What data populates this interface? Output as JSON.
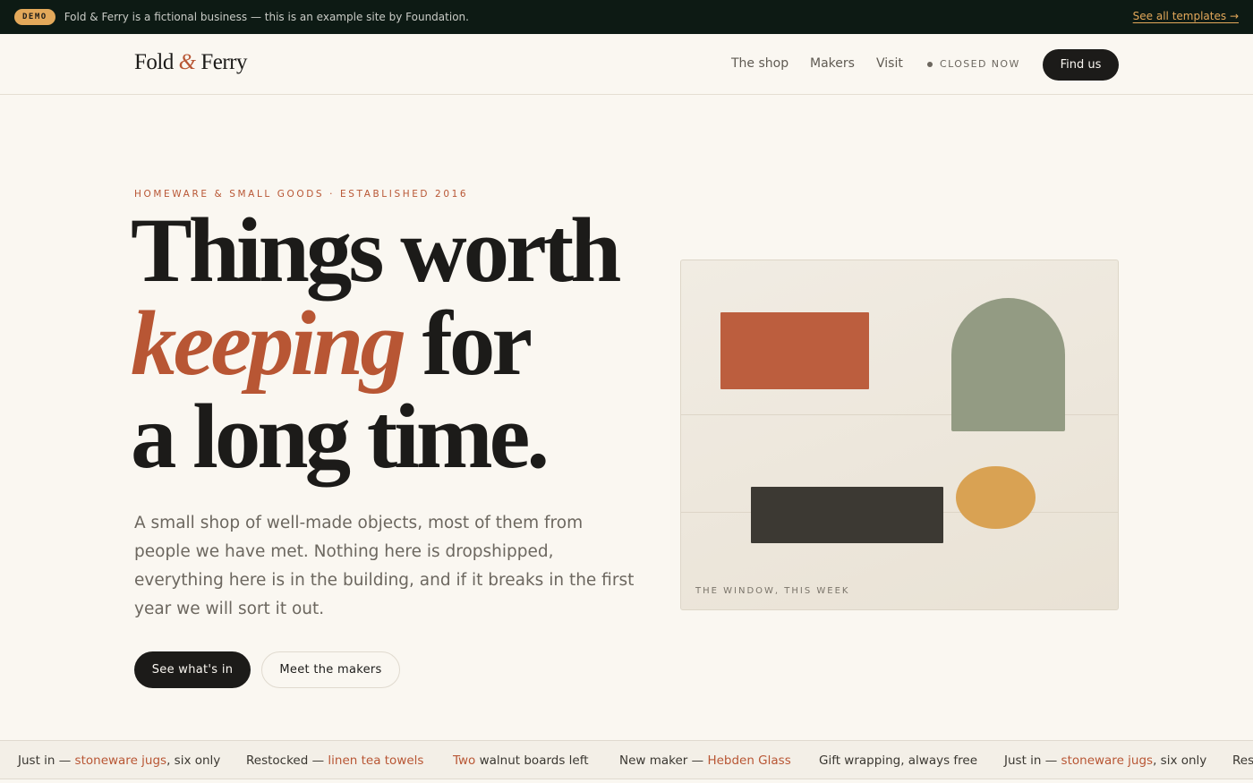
{
  "demo_bar": {
    "badge": "DEMO",
    "text": "Fold & Ferry is a fictional business — this is an example site by Foundation.",
    "link": "See all templates →"
  },
  "header": {
    "logo_part1": "Fold",
    "logo_amp": "&",
    "logo_part2": "Ferry",
    "nav": [
      "The shop",
      "Makers",
      "Visit"
    ],
    "status": "CLOSED NOW",
    "cta": "Find us"
  },
  "hero": {
    "eyebrow": "HOMEWARE & SMALL GOODS · ESTABLISHED 2016",
    "headline_line1": "Things worth",
    "headline_accent": "keeping",
    "headline_line2_rest": " for",
    "headline_line3": "a long time.",
    "lede": "A small shop of well-made objects, most of them from people we have met. Nothing here is dropshipped, everything here is in the building, and if it breaks in the first year we will sort it out.",
    "primary_button": "See what's in",
    "secondary_button": "Meet the makers"
  },
  "window": {
    "caption": "THE WINDOW, THIS WEEK"
  },
  "ticker": [
    {
      "pre": "Just in — ",
      "hl": "stoneware jugs",
      "post": ", six only"
    },
    {
      "pre": "Restocked — ",
      "hl": "linen tea towels",
      "post": ""
    },
    {
      "pre": "",
      "hl": "Two",
      "post": " walnut boards left"
    },
    {
      "pre": "New maker — ",
      "hl": "Hebden Glass",
      "post": ""
    },
    {
      "pre": "Gift wrapping, always free",
      "hl": "",
      "post": ""
    },
    {
      "pre": "Just in — ",
      "hl": "stoneware jugs",
      "post": ", six only"
    },
    {
      "pre": "Res",
      "hl": "",
      "post": ""
    }
  ],
  "colors": {
    "accent": "#b85634",
    "ink": "#1c1b19",
    "paper": "#faf7f1",
    "demo_bar": "#0d1a14",
    "demo_badge": "#e3a85a",
    "sage": "#939b83",
    "ochre": "#d9a253"
  }
}
